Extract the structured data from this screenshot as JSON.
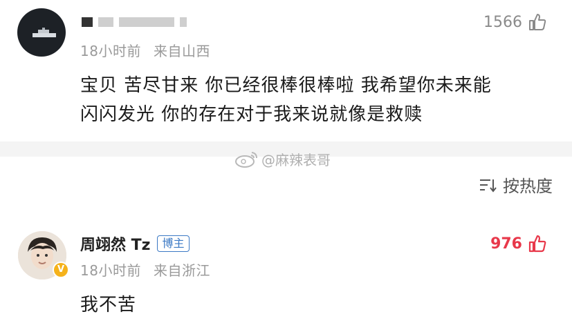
{
  "comment1": {
    "username_masked": true,
    "time": "18小时前",
    "location": "来自山西",
    "likes": "1566",
    "text_lines": [
      "宝贝 苦尽甘来 你已经很棒很棒啦 我希望你未来能",
      "闪闪发光 你的存在对于我来说就像是救赎"
    ]
  },
  "watermark": "@麻辣表哥",
  "sort": {
    "label": "按热度",
    "icon": "sort-icon"
  },
  "comment2": {
    "username": "周翊然 Tz",
    "badge": "博主",
    "verified_mark": "V",
    "time": "18小时前",
    "location": "来自浙江",
    "likes": "976",
    "liked": true,
    "text": "我不苦"
  },
  "colors": {
    "like_active": "#e8384a",
    "badge": "#3a78c4",
    "meta": "#9a9a9a"
  }
}
